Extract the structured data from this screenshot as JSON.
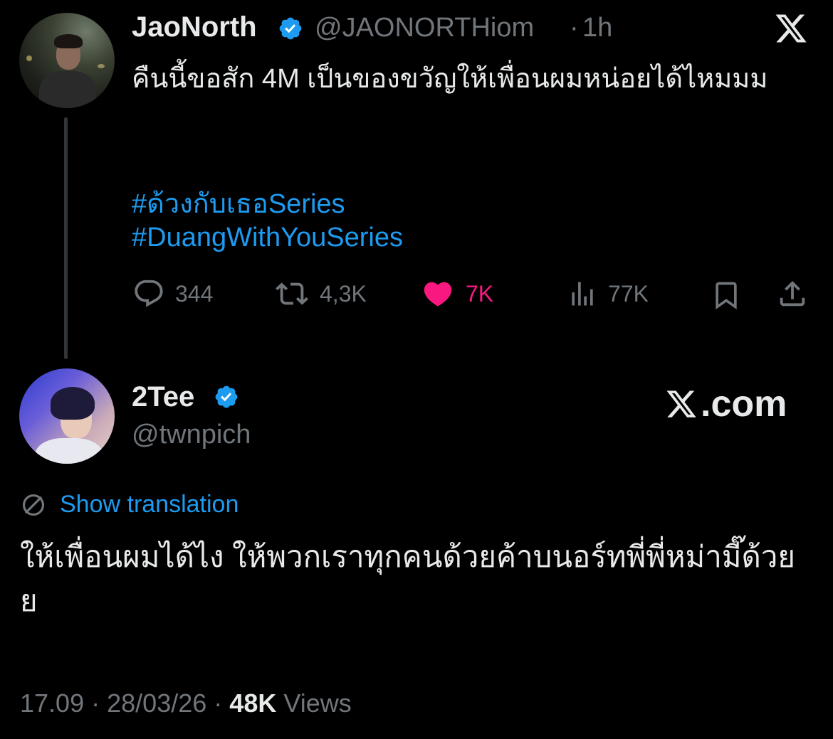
{
  "parent_tweet": {
    "display_name": "JaoNorth",
    "handle": "@JAONORTHiom",
    "separator": "·",
    "time": "1h",
    "text": "คืนนี้ขอสัก 4M เป็นของขวัญให้เพื่อนผมหน่อยได้ไหมมม",
    "hashtags": [
      "#ด้วงกับเธอSeries",
      "#DuangWithYouSeries"
    ],
    "actions": {
      "replies": "344",
      "retweets": "4,3K",
      "likes": "7K",
      "views": "77K"
    },
    "verified": true
  },
  "reply_tweet": {
    "display_name": "2Tee",
    "handle": "@twnpich",
    "verified": true,
    "show_translation": "Show translation",
    "text": "ให้เพื่อนผมได้ไง ให้พวกเราทุกคนด้วยค้าบนอร์ทพี่พี่หม่ามี๊ด้วยย",
    "meta": {
      "time": "17.09",
      "separator": "·",
      "date": "28/03/26",
      "views_count": "48K",
      "views_label": "Views"
    }
  },
  "branding": {
    "watermark": ".com"
  },
  "colors": {
    "background": "#000000",
    "text_primary": "#e7e9ea",
    "text_secondary": "#71767b",
    "link": "#1d9bf0",
    "like": "#f91880",
    "verified": "#1d9bf0"
  },
  "icons": [
    "x-logo-icon",
    "verified-badge-icon",
    "reply-icon",
    "retweet-icon",
    "heart-icon",
    "views-icon",
    "bookmark-icon",
    "share-icon",
    "translate-icon"
  ]
}
